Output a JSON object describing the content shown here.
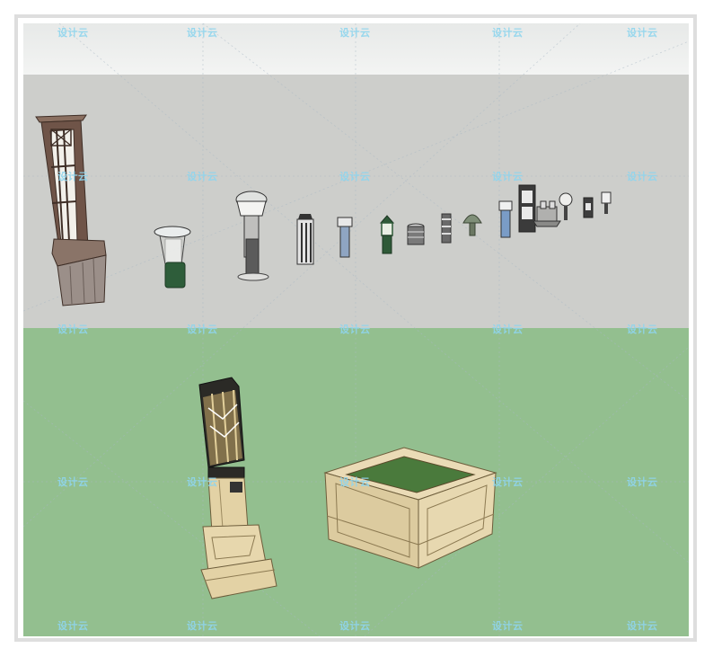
{
  "watermark": {
    "text": "设计云",
    "color": "#8fd5ee",
    "positions_note_hidden": ""
  },
  "scene": {
    "sky_color": "#ecefee",
    "wall_color": "#cdcecb",
    "ground_color": "#93bf8f"
  },
  "objects": [
    {
      "name": "tall-lattice-column-lamp"
    },
    {
      "name": "green-canopy-bollard-lamp"
    },
    {
      "name": "gray-dome-bollard-lamp"
    },
    {
      "name": "slatted-bollard-lamp"
    },
    {
      "name": "blue-slim-bollard-lamp"
    },
    {
      "name": "green-pagoda-lamp"
    },
    {
      "name": "drum-lamp"
    },
    {
      "name": "striped-post-lamp"
    },
    {
      "name": "mushroom-lamp"
    },
    {
      "name": "blue-post-lamp"
    },
    {
      "name": "square-column-lamp"
    },
    {
      "name": "pavilion-lamp-group"
    },
    {
      "name": "globe-post-lamp"
    },
    {
      "name": "small-cube-lamp"
    },
    {
      "name": "small-post-lamp"
    },
    {
      "name": "art-deco-pillar-lamp"
    },
    {
      "name": "square-planter-box"
    }
  ]
}
